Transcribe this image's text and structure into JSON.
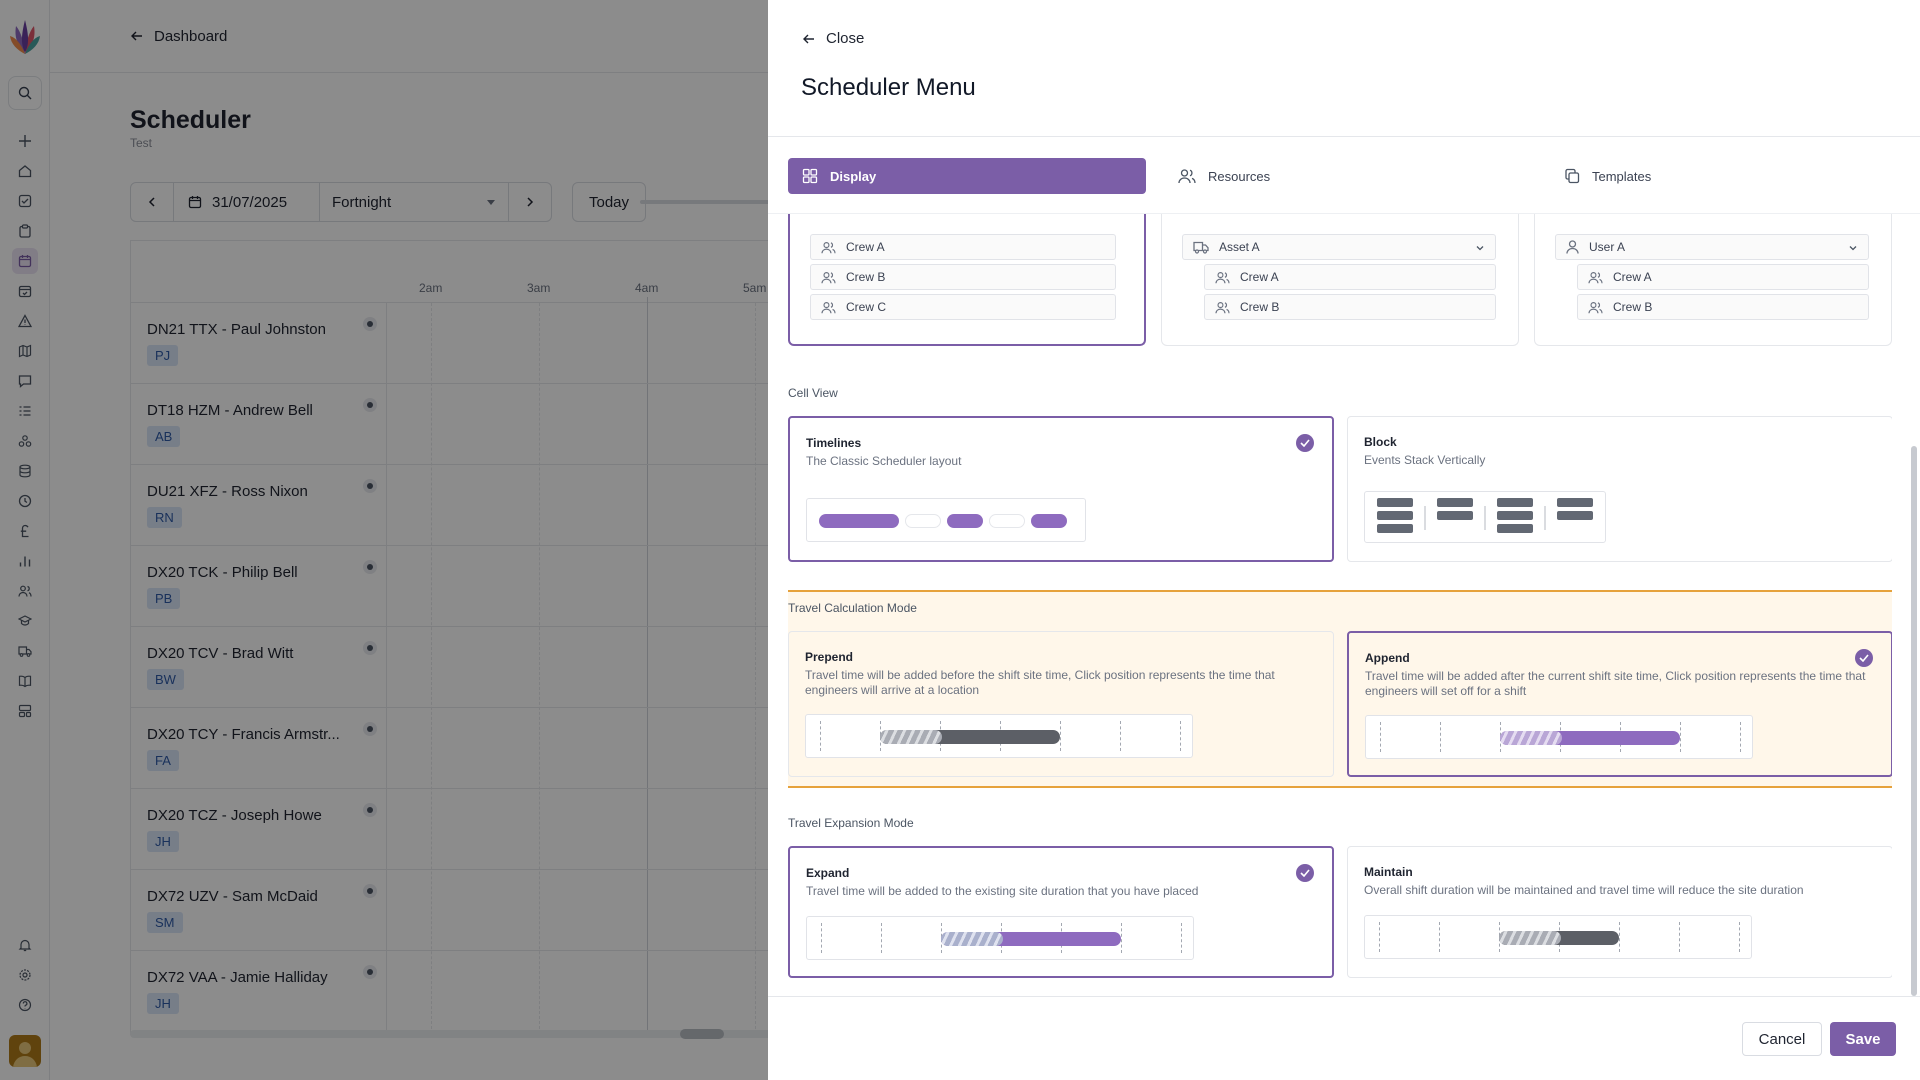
{
  "breadcrumb": {
    "back_label": "Dashboard"
  },
  "page": {
    "title": "Scheduler",
    "subtitle": "Test"
  },
  "toolbar": {
    "date": "31/07/2025",
    "period": "Fortnight",
    "today_label": "Today"
  },
  "timeline": {
    "hours": [
      "2am",
      "3am",
      "4am",
      "5am"
    ]
  },
  "resources": [
    {
      "name": "DN21 TTX - Paul Johnston",
      "badge": "PJ"
    },
    {
      "name": "DT18 HZM - Andrew Bell",
      "badge": "AB"
    },
    {
      "name": "DU21 XFZ - Ross Nixon",
      "badge": "RN"
    },
    {
      "name": "DX20 TCK - Philip Bell",
      "badge": "PB"
    },
    {
      "name": "DX20 TCV - Brad Witt",
      "badge": "BW"
    },
    {
      "name": "DX20 TCY - Francis Armstr...",
      "badge": "FA"
    },
    {
      "name": "DX20 TCZ - Joseph Howe",
      "badge": "JH"
    },
    {
      "name": "DX72 UZV - Sam McDaid",
      "badge": "SM"
    },
    {
      "name": "DX72 VAA - Jamie Halliday",
      "badge": "JH"
    }
  ],
  "drawer": {
    "close_label": "Close",
    "title": "Scheduler Menu",
    "tabs": [
      {
        "label": "Display",
        "icon": "grid-icon",
        "active": true
      },
      {
        "label": "Resources",
        "icon": "users-icon",
        "active": false
      },
      {
        "label": "Templates",
        "icon": "copy-icon",
        "active": false
      }
    ],
    "grouping": {
      "card1": {
        "items": [
          "Crew A",
          "Crew B",
          "Crew C"
        ]
      },
      "card2": {
        "header": "Asset A",
        "items": [
          "Crew A",
          "Crew B"
        ]
      },
      "card3": {
        "header": "User A",
        "items": [
          "Crew A",
          "Crew B"
        ]
      }
    },
    "cell_view": {
      "label": "Cell View",
      "options": [
        {
          "title": "Timelines",
          "desc": "The Classic Scheduler layout",
          "selected": true
        },
        {
          "title": "Block",
          "desc": "Events Stack Vertically",
          "selected": false
        }
      ]
    },
    "travel_calc": {
      "label": "Travel Calculation Mode",
      "options": [
        {
          "title": "Prepend",
          "desc": "Travel time will be added before the shift site time, Click position represents the time that engineers will arrive at a location",
          "selected": false
        },
        {
          "title": "Append",
          "desc": "Travel time will be added after the current shift site time, Click position represents the time that engineers will set off for a shift",
          "selected": true
        }
      ]
    },
    "travel_exp": {
      "label": "Travel Expansion Mode",
      "options": [
        {
          "title": "Expand",
          "desc": "Travel time will be added to the existing site duration that you have placed",
          "selected": true
        },
        {
          "title": "Maintain",
          "desc": "Overall shift duration will be maintained and travel time will reduce the site duration",
          "selected": false
        }
      ]
    },
    "cancel_label": "Cancel",
    "save_label": "Save"
  },
  "colors": {
    "accent": "#7b5ea7",
    "highlight_border": "#e6a23c",
    "highlight_bg": "#fff7ea",
    "badge_bg": "#d9e5f8"
  }
}
